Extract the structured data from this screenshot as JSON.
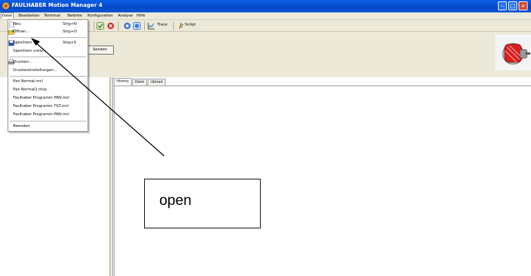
{
  "window": {
    "title": "FAULHABER Motion Manager 4"
  },
  "menubar": {
    "items": [
      {
        "label": "Datei"
      },
      {
        "label": "Bearbeiten"
      },
      {
        "label": "Terminal"
      },
      {
        "label": "Befehle"
      },
      {
        "label": "Konfiguration"
      },
      {
        "label": "Analyse"
      },
      {
        "label": "Hilfe"
      }
    ]
  },
  "toolbar": {
    "trace_label": "Trace",
    "script_label": "Script"
  },
  "send_button": {
    "label": "Senden"
  },
  "file_menu": {
    "items": [
      {
        "label": "Neu",
        "shortcut": "Strg+N",
        "icon": "new-file-icon"
      },
      {
        "label": "Öffnen...",
        "shortcut": "Strg+O",
        "icon": "open-folder-icon"
      },
      {
        "label": "Speichern",
        "shortcut": "Strg+S",
        "icon": "save-icon"
      },
      {
        "label": "Speichern unter...",
        "shortcut": ""
      },
      {
        "label": "Drucken...",
        "shortcut": "",
        "icon": "printer-icon"
      },
      {
        "label": "Druckereinstellungen...",
        "shortcut": ""
      },
      {
        "label": "Pan Normal.mcl",
        "shortcut": ""
      },
      {
        "label": "Pan Normal1.mcp",
        "shortcut": ""
      },
      {
        "label": "Faulhaber Programm PAN.mcl",
        "shortcut": ""
      },
      {
        "label": "Faulhaber Programm TILT.mcl",
        "shortcut": ""
      },
      {
        "label": "Faulhaber Programm PAN.mcl",
        "shortcut": ""
      },
      {
        "label": "Beenden",
        "shortcut": ""
      }
    ]
  },
  "tabs": [
    {
      "label": "History"
    },
    {
      "label": "Datei"
    },
    {
      "label": "Upload"
    }
  ],
  "annotation": {
    "text": "open"
  },
  "colors": {
    "titlebar": "#0a5ee6",
    "chrome": "#ece9d8",
    "close": "#d8462b"
  }
}
